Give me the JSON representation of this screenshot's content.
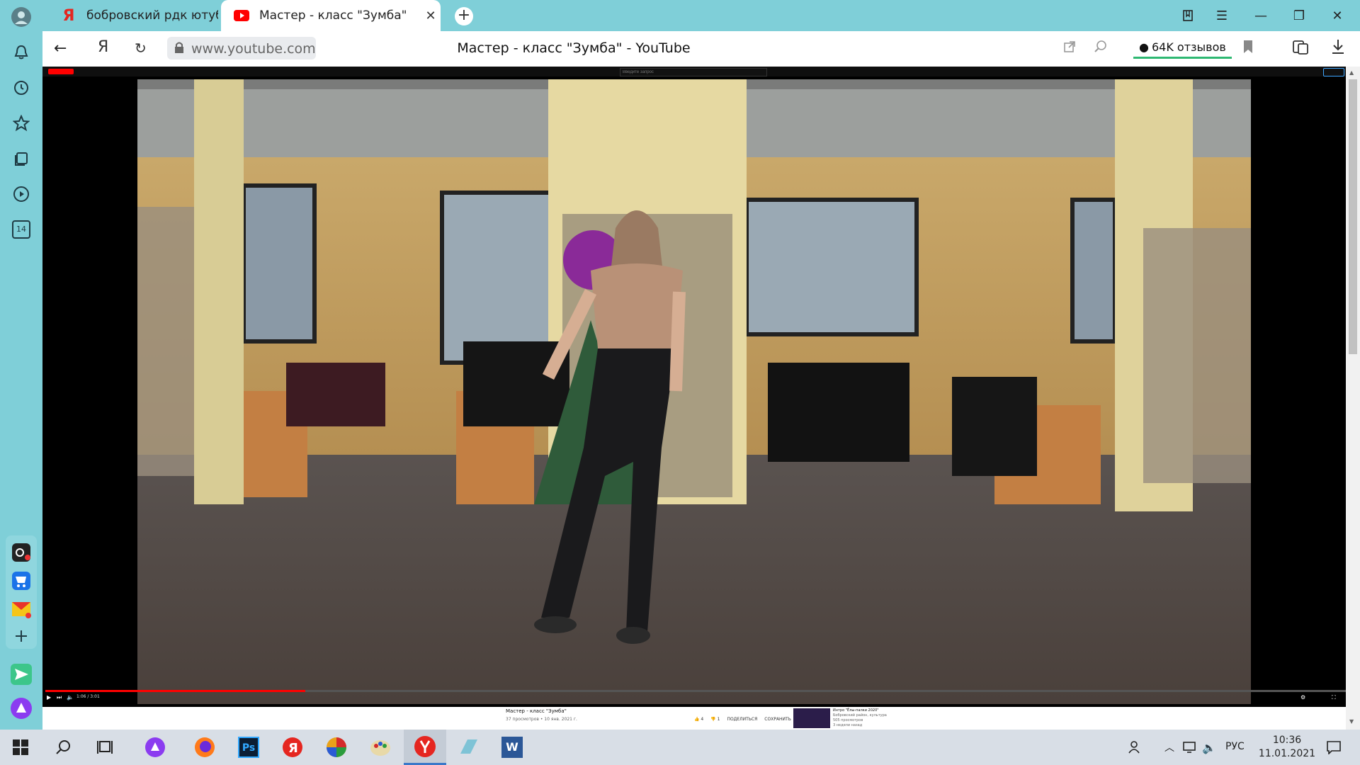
{
  "browser": {
    "tabs": [
      {
        "title": "бобровский рдк ютуб — Я",
        "favicon": "yandex-y-icon"
      },
      {
        "title": "Мастер - класс \"Зумба\"",
        "favicon": "youtube-icon",
        "active": true
      }
    ],
    "url": "www.youtube.com",
    "page_title": "Мастер - класс \"Зумба\" - YouTube",
    "reviews": "64K отзывов",
    "sidebar_badge": "14"
  },
  "youtube": {
    "search_placeholder": "Введите запрос",
    "video_title": "Мастер - класс \"Зумба\"",
    "video_meta": "37 просмотров • 10 янв. 2021 г.",
    "likes": "4",
    "dislikes": "1",
    "share": "ПОДЕЛИТЬСЯ",
    "save": "СОХРАНИТЬ",
    "time": "1:06 / 3:01",
    "progress": 0.2,
    "related": {
      "title": "Интро \"Ёлы-палки 2020\"",
      "channel": "Бобровский район, культура",
      "views": "505 просмотров",
      "age": "3 недели назад"
    }
  },
  "taskbar": {
    "lang": "РУС",
    "time": "10:36",
    "date": "11.01.2021"
  },
  "colors": {
    "chrome": "#7fcfd8",
    "youtube_red": "#ff0000",
    "taskbar": "#d8dee6"
  }
}
